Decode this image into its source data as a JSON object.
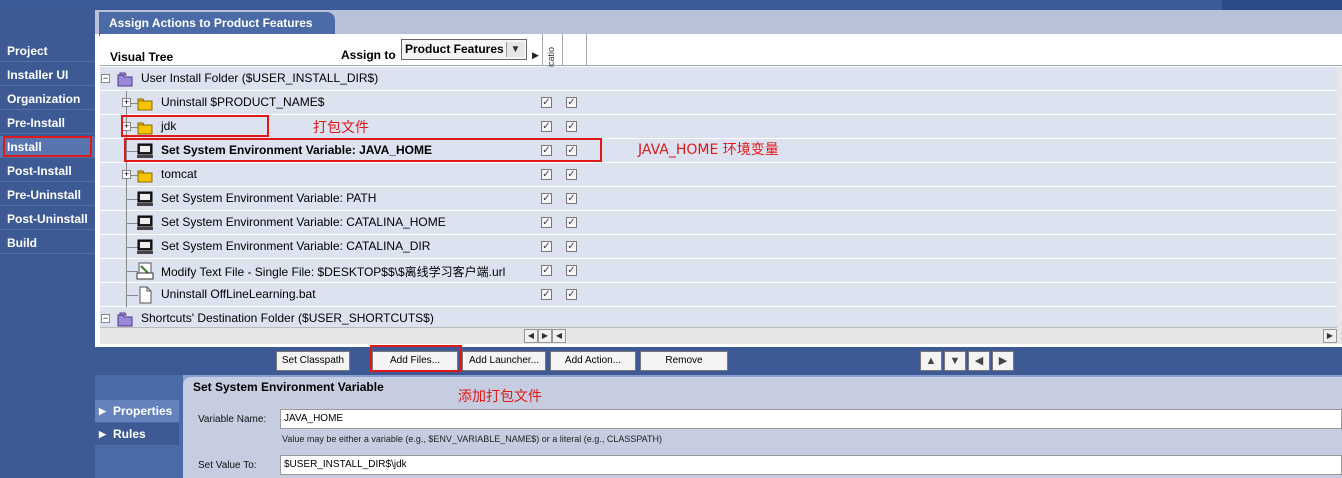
{
  "nav": {
    "items": [
      "Project",
      "Installer UI",
      "Organization",
      "Pre-Install",
      "Install",
      "Post-Install",
      "Pre-Uninstall",
      "Post-Uninstall",
      "Build"
    ],
    "active": "Install"
  },
  "panel": {
    "tab_title": "Assign Actions to Product Features",
    "visual_tree_label": "Visual Tree",
    "assign_to_label": "Assign to",
    "assign_to_value": "Product Features",
    "columns": [
      "Applicatio",
      "Help"
    ]
  },
  "tree": [
    {
      "label": "User Install Folder ($USER_INSTALL_DIR$)",
      "level": 0,
      "icon": "purple-folder-icon",
      "expander": "⊟",
      "checks": false,
      "bold": false
    },
    {
      "label": "Uninstall $PRODUCT_NAME$",
      "level": 1,
      "icon": "yellow-folder-icon",
      "expander": "+",
      "checks": true,
      "bold": false
    },
    {
      "label": "jdk",
      "level": 1,
      "icon": "yellow-folder-icon",
      "expander": "+",
      "checks": true,
      "bold": false
    },
    {
      "label": "Set System Environment Variable:  JAVA_HOME",
      "level": 1,
      "icon": "computer-icon",
      "expander": "",
      "checks": true,
      "bold": true
    },
    {
      "label": "tomcat",
      "level": 1,
      "icon": "yellow-folder-icon",
      "expander": "+",
      "checks": true,
      "bold": false
    },
    {
      "label": "Set System Environment Variable:  PATH",
      "level": 1,
      "icon": "computer-icon",
      "expander": "",
      "checks": true,
      "bold": false
    },
    {
      "label": "Set System Environment Variable:  CATALINA_HOME",
      "level": 1,
      "icon": "computer-icon",
      "expander": "",
      "checks": true,
      "bold": false
    },
    {
      "label": "Set System Environment Variable:  CATALINA_DIR",
      "level": 1,
      "icon": "computer-icon",
      "expander": "",
      "checks": true,
      "bold": false
    },
    {
      "label": "Modify Text File - Single File: $DESKTOP$$\\$离线学习客户端.url",
      "level": 1,
      "icon": "ascii-file-icon",
      "expander": "",
      "checks": true,
      "bold": false
    },
    {
      "label": "Uninstall OffLineLearning.bat",
      "level": 1,
      "icon": "document-icon",
      "expander": "",
      "checks": true,
      "bold": false
    },
    {
      "label": "Shortcuts' Destination Folder ($USER_SHORTCUTS$)",
      "level": 0,
      "icon": "purple-folder-icon",
      "expander": "⊟",
      "checks": false,
      "bold": false
    }
  ],
  "buttons": {
    "set_classpath": "Set Classpath",
    "add_files": "Add Files...",
    "add_launcher": "Add Launcher...",
    "add_action": "Add Action...",
    "remove": "Remove"
  },
  "properties": {
    "side_properties": "Properties",
    "side_rules": "Rules",
    "section_title": "Set System Environment Variable",
    "variable_name_label": "Variable Name:",
    "variable_name_value": "JAVA_HOME",
    "hint": "Value may be either a variable (e.g., $ENV_VARIABLE_NAME$) or a literal (e.g., CLASSPATH)",
    "set_value_label": "Set Value To:",
    "set_value_value": "$USER_INSTALL_DIR$\\jdk"
  },
  "annotations": {
    "pack_files": "打包文件",
    "java_home_env": "JAVA_HOME 环境变量",
    "add_pack_files": "添加打包文件"
  },
  "colors": {
    "nav_bg": "#3d5a94",
    "tree_row_bg": "#dde2f1",
    "highlight_red": "#e01818"
  }
}
